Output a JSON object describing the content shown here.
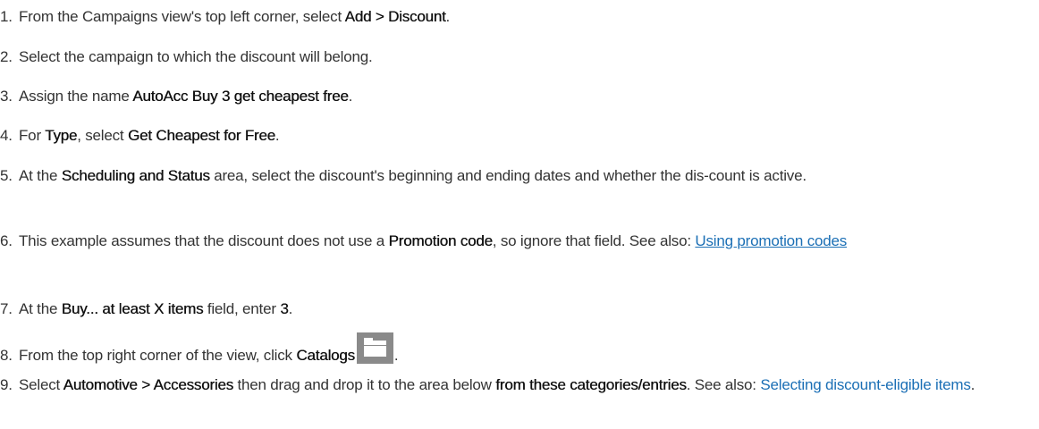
{
  "steps": [
    {
      "num": "1.",
      "t1": "From the Campaigns view's top left corner, select ",
      "b1": "Add > Discount",
      "t2": "."
    },
    {
      "num": "2.",
      "t1": "Select the campaign to which the discount will belong."
    },
    {
      "num": "3.",
      "t1": "Assign the name ",
      "b1": "AutoAcc Buy 3 get cheapest free",
      "t2": "."
    },
    {
      "num": "4.",
      "t1": "For ",
      "b1": "Type",
      "t2": ", select ",
      "b2": "Get Cheapest for Free",
      "t3": "."
    },
    {
      "num": "5.",
      "t1": "At the ",
      "b1": "Scheduling and Status",
      "t2": " area, select the discount's beginning and ending dates and whether the dis-count is active."
    },
    {
      "num": "6.",
      "t1": "This example assumes that the discount does not use a ",
      "b1": "Promotion code",
      "t2": ", so ignore that field. See also: ",
      "link": "Using promotion codes"
    },
    {
      "num": "7.",
      "t1": "At the ",
      "b1": "Buy... at least X items",
      "t2": " field, enter ",
      "b2": "3",
      "t3": "."
    },
    {
      "num": "8.",
      "t1": "From the top right corner of the view, click ",
      "b1": "Catalogs",
      "icon": "folder-icon",
      "t2": "."
    },
    {
      "num": "9.",
      "t1": "Select ",
      "b1": "Automotive > Accessories",
      "t2": " then drag and drop it to the area below ",
      "b2": "from these categories/entries",
      "t3": ". See also: ",
      "link": "Selecting discount-eligible items",
      "t4": "."
    }
  ]
}
